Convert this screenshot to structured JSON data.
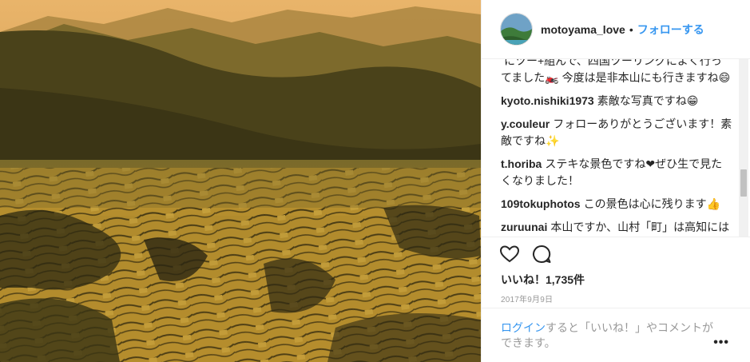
{
  "post": {
    "username": "motoyama_love",
    "separator": "•",
    "follow_label": "フォローする",
    "photo_icon": "rice-terraces-photo"
  },
  "comments": [
    {
      "user": "",
      "text": "にツー+組んで、四国ツーリングによく行ってました🏍️ 今度は是非本山にも行きますね😄"
    },
    {
      "user": "kyoto.nishiki1973",
      "text": "素敵な写真ですね😁"
    },
    {
      "user": "y.couleur",
      "text": "フォローありがとうございます！素敵ですね✨"
    },
    {
      "user": "t.horiba",
      "text": "ステキな景色ですね❤ぜひ生で見たくなりました！"
    },
    {
      "user": "109tokuphotos",
      "text": "この景色は心に残ります👍"
    },
    {
      "user": "zuruunai",
      "text": "本山ですか、山村「町」は高知にはよくありますね。かくいう自分は物部町"
    }
  ],
  "actions": {
    "like_icon": "heart-icon",
    "comment_icon": "comment-bubble-icon"
  },
  "likes_text": "いいね！1,735件",
  "date_text": "2017年9月9日",
  "login": {
    "link": "ログイン",
    "rest": "すると「いいね！」やコメントができます。"
  },
  "more_label": "•••",
  "colors": {
    "link": "#3897f0",
    "muted": "#999999",
    "text": "#262626"
  }
}
